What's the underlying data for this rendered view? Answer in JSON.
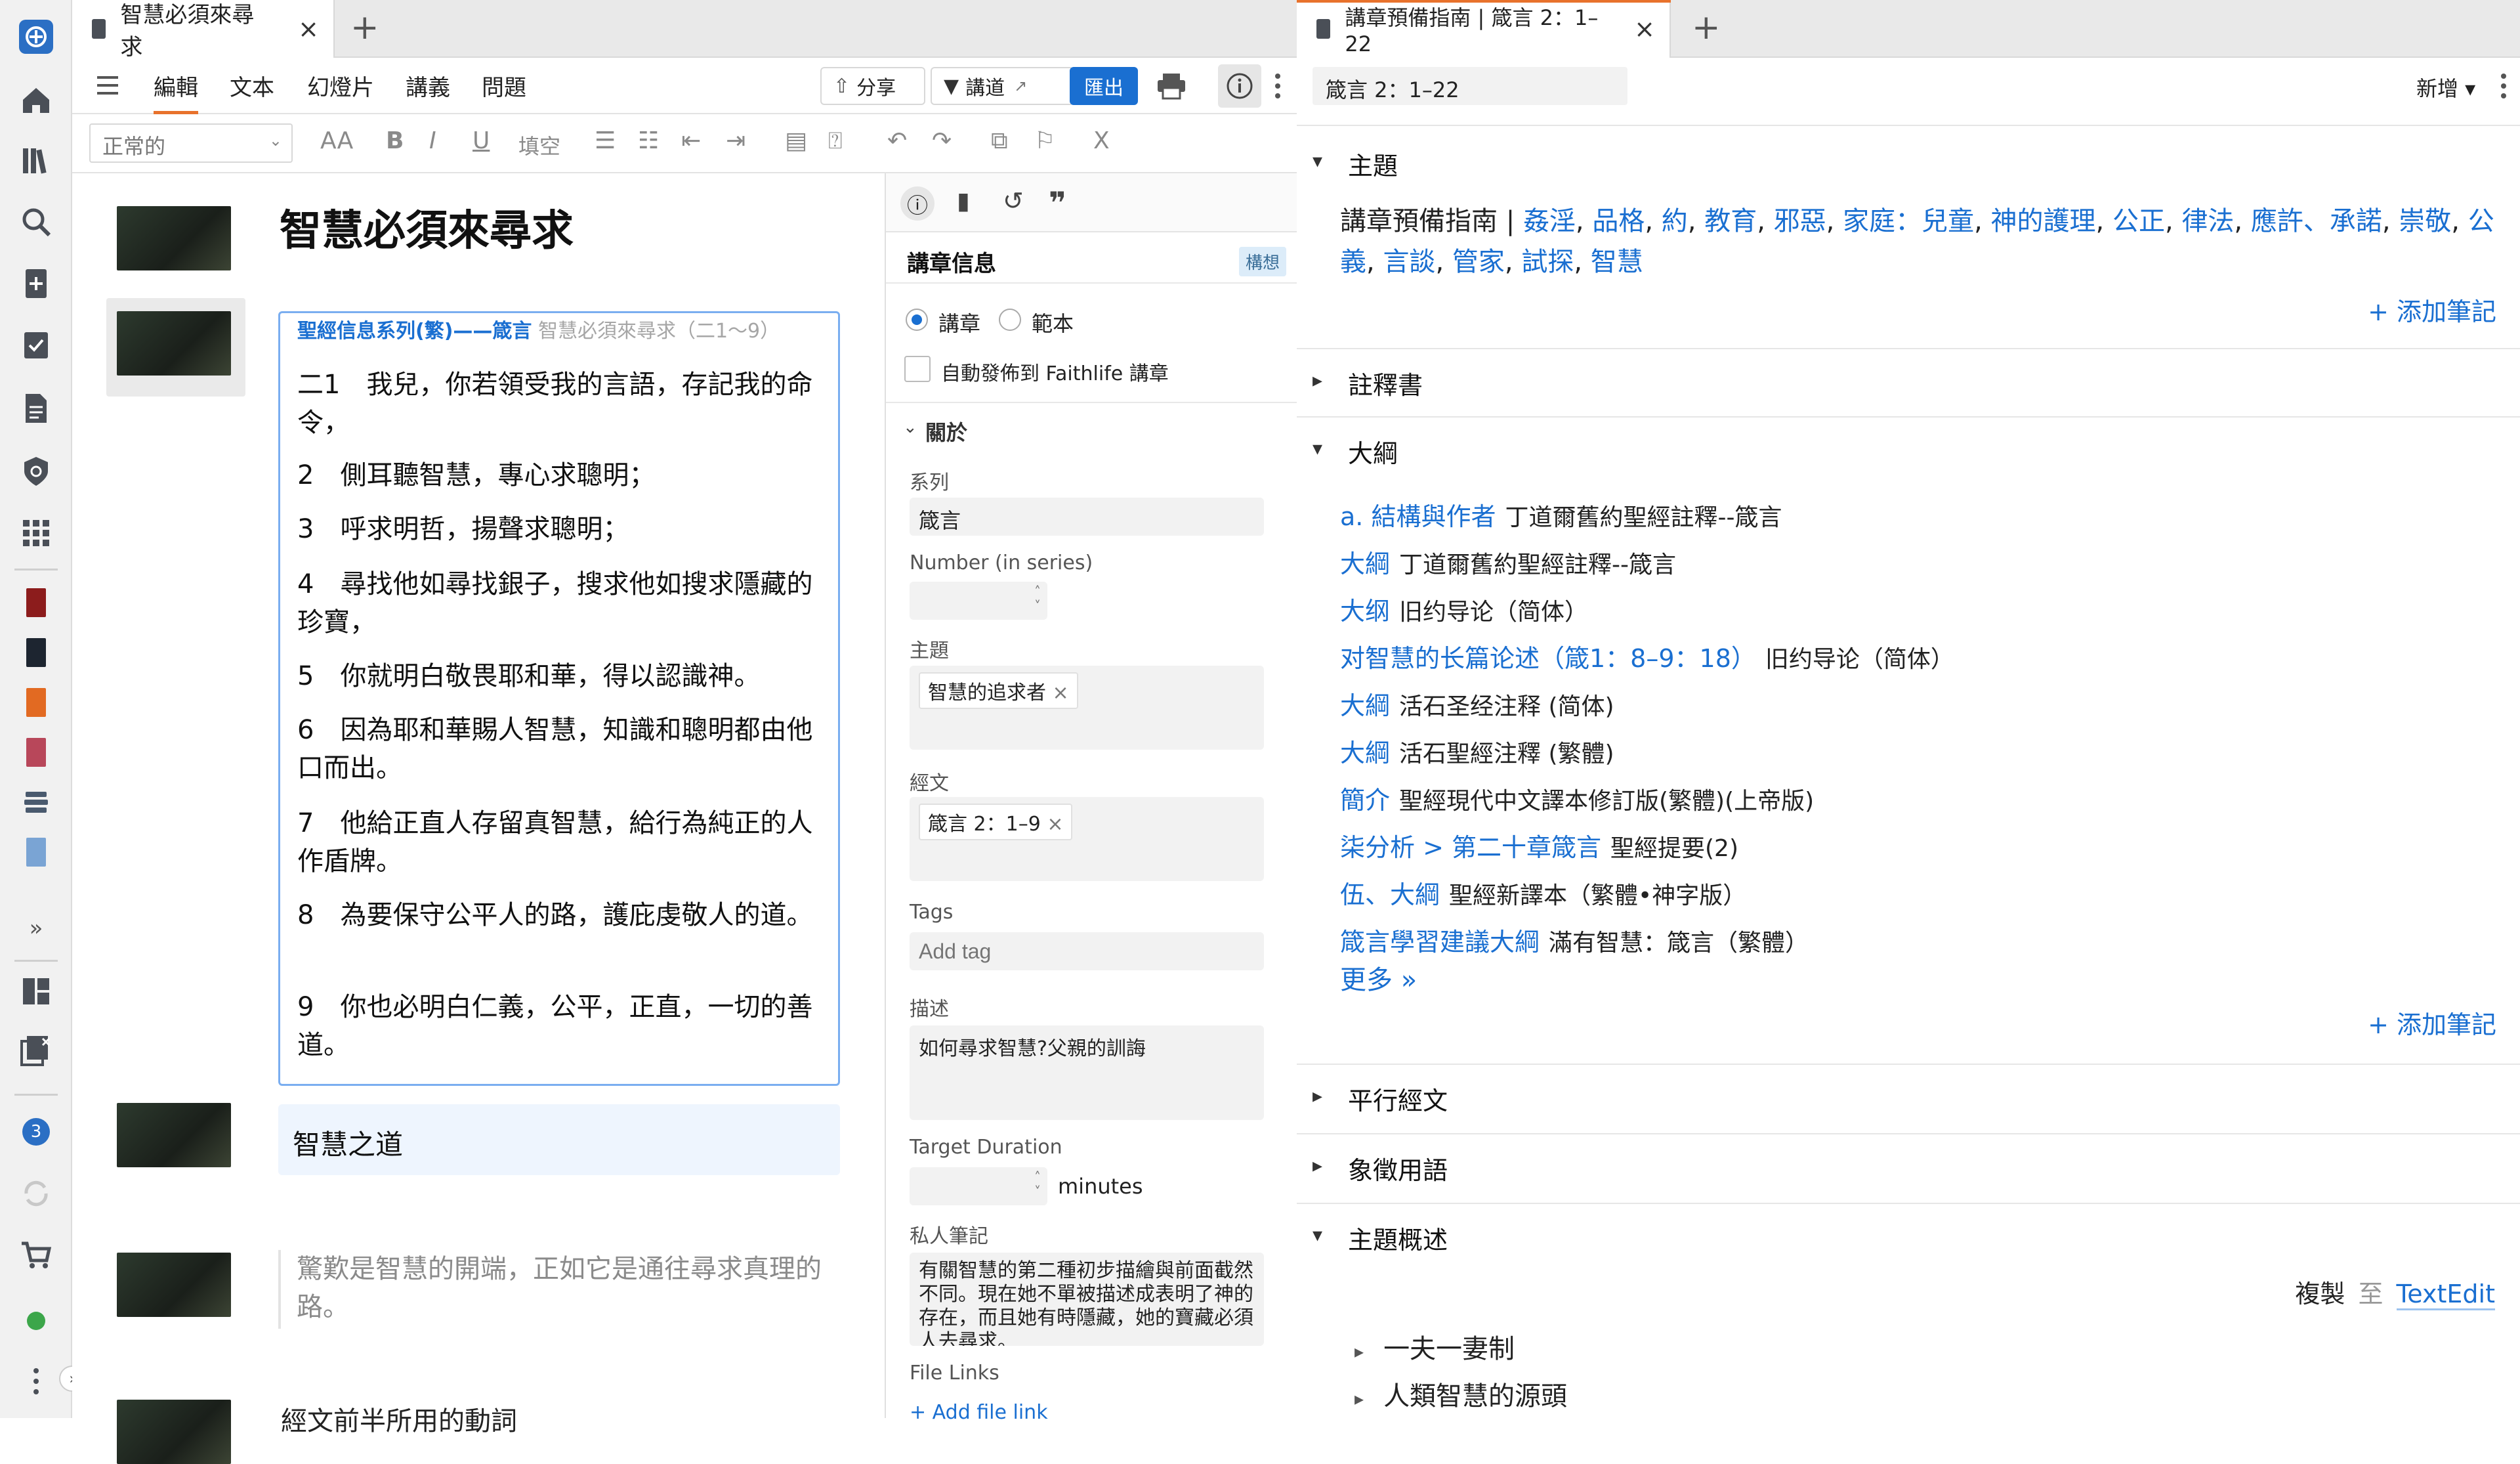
{
  "rail": {
    "icons": [
      "logos-icon",
      "home-icon",
      "library-icon",
      "search-icon",
      "add-doc-icon",
      "checklist-icon",
      "document-icon",
      "shield-icon",
      "apps-icon",
      "book-red-icon",
      "book-dark-icon",
      "book-orange-icon",
      "book-pink-icon",
      "layers-icon",
      "calendar-icon",
      "expand-icon",
      "dashboard-icon",
      "close-panels-icon",
      "notification-icon",
      "sync-icon",
      "cart-icon",
      "user-icon",
      "more-icon"
    ],
    "notification_count": "3",
    "expand_label": "»"
  },
  "left": {
    "tab_title": "智慧必須來尋求",
    "tab_close": "×",
    "tab_add": "+",
    "menu": [
      "編輯",
      "文本",
      "幻燈片",
      "講義",
      "問題"
    ],
    "share_label": "分享",
    "preach_label": "講道",
    "export_label": "匯出",
    "style_select": "正常的",
    "font_size_label": "AA",
    "bold": "B",
    "italic": "I",
    "underline": "U",
    "fill_label": "填空",
    "doc_title": "智慧必須來尋求",
    "verse_header_series": "聖經信息系列(繁)——箴言",
    "verse_header_rest": " 智慧必須來尋求（二1～9）",
    "verses": [
      "二1　我兒，你若領受我的言語，存記我的命令，",
      "2　側耳聽智慧，專心求聰明；",
      "3　呼求明哲，揚聲求聰明；",
      "4　尋找他如尋找銀子，搜求他如搜求隱藏的珍寶，",
      "5　你就明白敬畏耶和華，得以認識神。",
      "6　因為耶和華賜人智慧，知識和聰明都由他口而出。",
      "7　他給正直人存留真智慧，給行為純正的人作盾牌。",
      "8　為要保守公平人的路，護庇虔敬人的道。",
      "9　你也必明白仁義，公平，正直，一切的善道。"
    ],
    "slide2_text": "智慧之道",
    "slide3_text": "驚歎是智慧的開端，正如它是通往尋求真理的路。",
    "slide4_text": "經文前半所用的動詞"
  },
  "info": {
    "heading": "講章信息",
    "badge": "構想",
    "radio_sermon": "講章",
    "radio_template": "範本",
    "auto_publish": "自動發佈到 Faithlife 講章",
    "about": "關於",
    "series_label": "系列",
    "series_value": "箴言",
    "number_label": "Number (in series)",
    "topic_label": "主題",
    "topic_chip": "智慧的追求者",
    "passage_label": "經文",
    "passage_chip": "箴言 2：1–9",
    "tags_label": "Tags",
    "tags_placeholder": "Add tag",
    "desc_label": "描述",
    "desc_value": "如何尋求智慧?父親的訓誨",
    "duration_label": "Target Duration",
    "duration_unit": "minutes",
    "notes_label": "私人筆記",
    "notes_value": "有關智慧的第二種初步描繪與前面截然不同。現在她不單被描述成表明了神的存在，而且她有時隱藏，她的寶藏必須人去尋求。",
    "file_links_label": "File Links",
    "add_file_link": "+ Add file link",
    "chip_remove": "×"
  },
  "right": {
    "tab_title": "講章預備指南 | 箴言 2：1–22",
    "tab_close": "×",
    "tab_add": "+",
    "reference": "箴言 2：1–22",
    "new_label": "新增 ▾",
    "sections": {
      "topics": "主題",
      "commentaries": "註釋書",
      "outlines": "大綱",
      "parallel": "平行經文",
      "figurative": "象徵用語",
      "topic_overview": "主題概述"
    },
    "topics_prefix": "講章預備指南 | ",
    "topics_links": [
      "姦淫",
      "品格",
      "約",
      "教育",
      "邪惡",
      "家庭：兒童",
      "神的護理",
      "公正",
      "律法",
      "應許、承諾",
      "崇敬",
      "公義",
      "言談",
      "管家",
      "試探",
      "智慧"
    ],
    "add_note": "+ 添加筆記",
    "outlines": [
      {
        "link": "a. 結構與作者",
        "source": "丁道爾舊約聖經註釋--箴言"
      },
      {
        "link": "大綱",
        "source": "丁道爾舊約聖經註釋--箴言"
      },
      {
        "link": "大纲",
        "source": "旧约导论（简体）"
      },
      {
        "link": "对智慧的长篇论述（箴1：8–9：18）",
        "source": "旧约导论（简体）"
      },
      {
        "link": "大綱",
        "source": "活石圣经注释 (简体)"
      },
      {
        "link": "大綱",
        "source": "活石聖經注釋 (繁體)"
      },
      {
        "link": "簡介",
        "source": "聖經現代中文譯本修訂版(繁體)(上帝版)"
      },
      {
        "link": "柒分析 > 第二十章箴言",
        "source": "聖經提要(2)"
      },
      {
        "link": "伍、大綱",
        "source": "聖經新譯本（繁體•神字版）"
      },
      {
        "link": "箴言學習建議大綱",
        "source": "滿有智慧：箴言（繁體）"
      }
    ],
    "more": "更多 »",
    "copy_label": "複製",
    "copy_to": "至",
    "copy_target": "TextEdit",
    "overview_items": [
      "一夫一妻制",
      "人類智慧的源頭"
    ]
  },
  "colors": {
    "accent_blue": "#1a6fd1",
    "accent_orange": "#e8722c",
    "rail_bg": "#f1f1f1"
  }
}
